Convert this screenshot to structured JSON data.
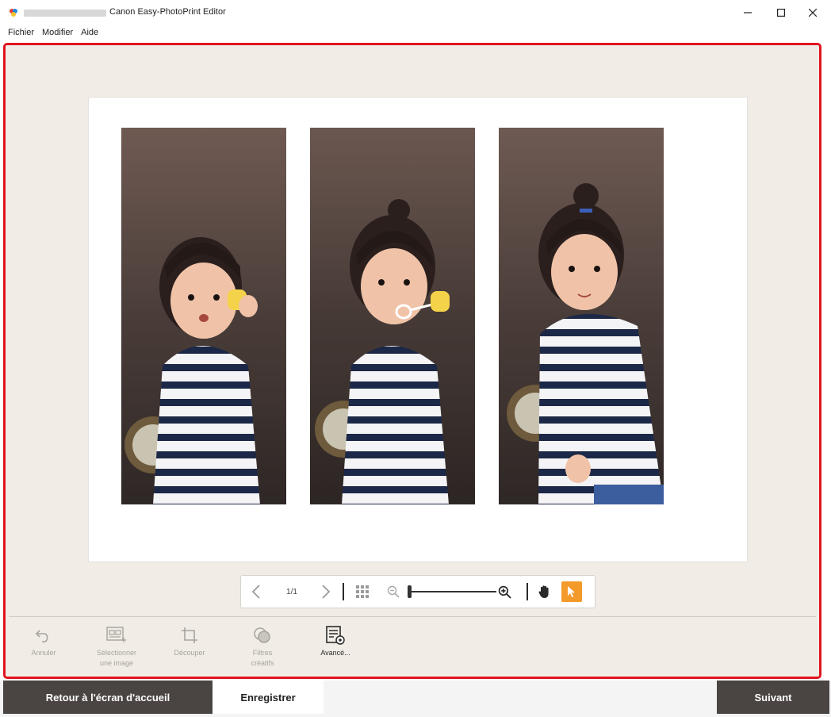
{
  "window": {
    "title": "Canon Easy-PhotoPrint Editor",
    "minimize_icon": "minimize-icon",
    "maximize_icon": "maximize-icon",
    "close_icon": "close-icon"
  },
  "menu": {
    "file": "Fichier",
    "edit": "Modifier",
    "help": "Aide"
  },
  "viewbar": {
    "page": "1/1",
    "zoom_level": 0.0
  },
  "tools": {
    "undo": "Annuler",
    "select_image_l1": "Sélectionner",
    "select_image_l2": "une image",
    "crop": "Découper",
    "filters_l1": "Filtres",
    "filters_l2": "créatifs",
    "advanced": "Avancé..."
  },
  "footer": {
    "home": "Retour à l'écran d'accueil",
    "save": "Enregistrer",
    "next": "Suivant"
  },
  "colors": {
    "accent": "#f39a2b",
    "selection_border": "#e0141e",
    "dark_button": "#4a4542"
  }
}
